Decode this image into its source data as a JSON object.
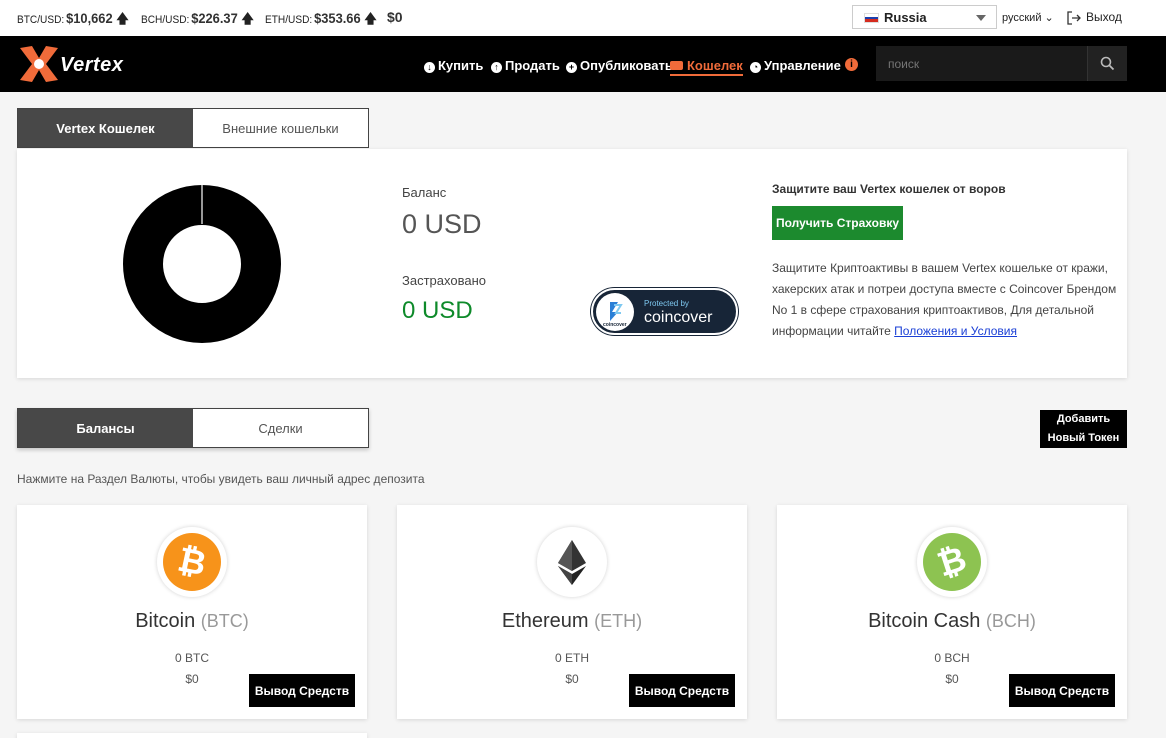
{
  "ticker": {
    "btc_label": "BTC/USD:",
    "btc_value": "$10,662",
    "bch_label": "BCH/USD:",
    "bch_value": "$226.37",
    "eth_label": "ETH/USD:",
    "eth_value": "$353.66",
    "total": "$0",
    "country": "Russia",
    "language": "русский",
    "logout": "Выход"
  },
  "nav": {
    "logo": "Vertex",
    "buy": "Купить",
    "sell": "Продать",
    "publish": "Опубликовать",
    "wallet": "Кошелек",
    "manage": "Управление",
    "search_placeholder": "поиск"
  },
  "wallet_tabs": [
    "Vertex Кошелек",
    "Внешние кошельки"
  ],
  "summary": {
    "balance_label": "Баланс",
    "balance_value": "0 USD",
    "insured_label": "Застраховано",
    "insured_value": "0 USD",
    "coincover_small": "Protected by",
    "coincover_name": "coincover",
    "coincover_tiny": "coincover",
    "protect_title": "Защитите ваш Vertex кошелек от воров",
    "insure_button": "Получить Страховку",
    "protect_text": "Защитите Криптоактивы в вашем Vertex кошельке от кражи, хакерских атак и потреи доступа вместе с Coincover Брендом No 1 в сфере страхования криптоактивов, Для детальной информации читайте",
    "terms_link": "Положения и Условия"
  },
  "section_tabs": [
    "Балансы",
    "Сделки"
  ],
  "add_token": "Добавить Новый Токен",
  "hint": "Нажмите на Раздел Валюты, чтобы увидеть ваш личный адрес депозита",
  "coins": [
    {
      "name": "Bitcoin",
      "ticker": "(BTC)",
      "amount": "0 BTC",
      "usd": "$0",
      "withdraw": "Вывод Средств",
      "color": "#f7931a"
    },
    {
      "name": "Ethereum",
      "ticker": "(ETH)",
      "amount": "0 ETH",
      "usd": "$0",
      "withdraw": "Вывод Средств",
      "color": "#222222"
    },
    {
      "name": "Bitcoin Cash",
      "ticker": "(BCH)",
      "amount": "0 BCH",
      "usd": "$0",
      "withdraw": "Вывод Средств",
      "color": "#8dc351"
    }
  ]
}
